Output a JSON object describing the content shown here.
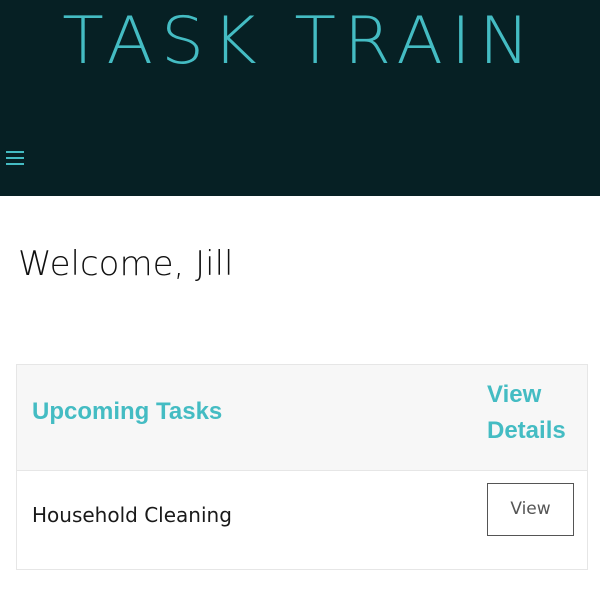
{
  "header": {
    "brand": "Task Train",
    "menu_icon": "hamburger-menu-icon"
  },
  "welcome": {
    "text": "Welcome, Jill"
  },
  "card": {
    "title": "Upcoming Tasks",
    "view_details_label": "View Details",
    "tasks": [
      {
        "name": "Household Cleaning",
        "button_label": "View"
      }
    ]
  },
  "colors": {
    "header_bg": "#062024",
    "accent": "#44bcc3",
    "card_header_bg": "#f7f7f7",
    "text": "#111111"
  }
}
